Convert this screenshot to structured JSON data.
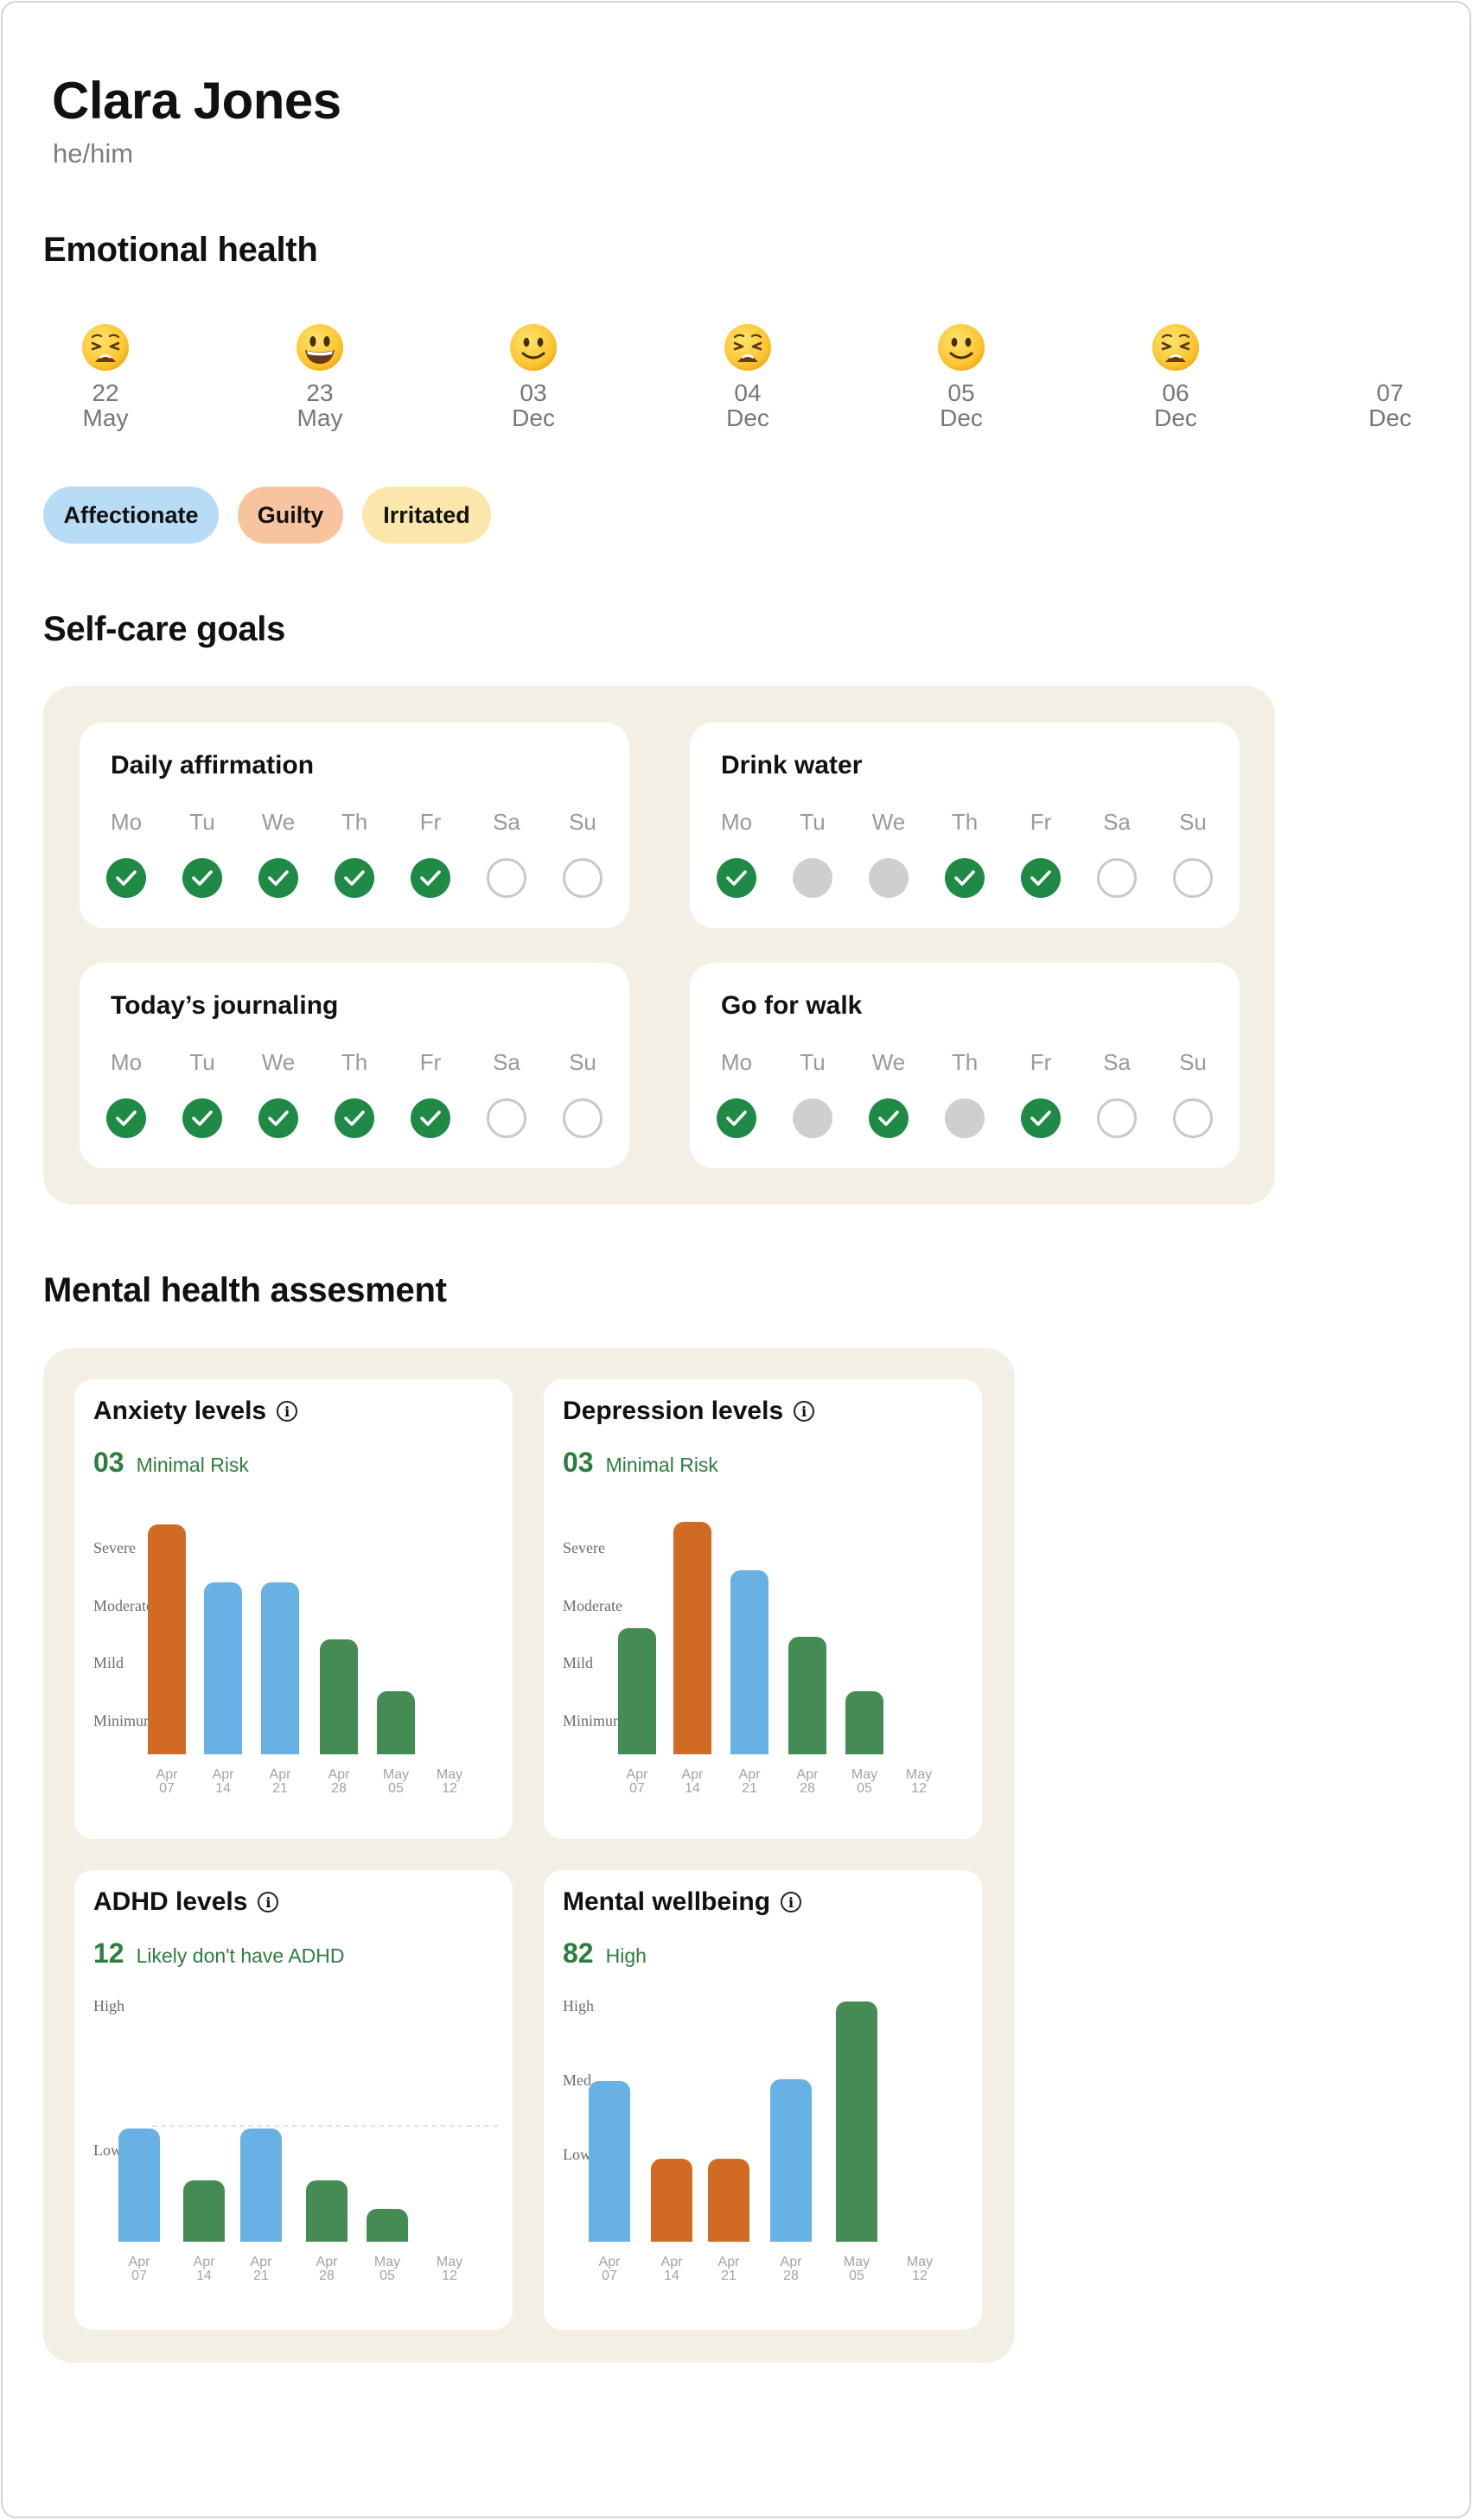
{
  "profile": {
    "name": "Clara Jones",
    "pronouns": "he/him"
  },
  "emotional": {
    "title": "Emotional health",
    "entries": [
      {
        "day": "22",
        "month": "May",
        "mood": "weary-face-icon"
      },
      {
        "day": "23",
        "month": "May",
        "mood": "grinning-face-icon"
      },
      {
        "day": "03",
        "month": "Dec",
        "mood": "slightly-smiling-face-icon"
      },
      {
        "day": "04",
        "month": "Dec",
        "mood": "weary-face-icon"
      },
      {
        "day": "05",
        "month": "Dec",
        "mood": "slightly-smiling-face-icon"
      },
      {
        "day": "06",
        "month": "Dec",
        "mood": "weary-face-icon"
      },
      {
        "day": "07",
        "month": "Dec",
        "mood": ""
      }
    ],
    "tags": [
      {
        "label": "Affectionate",
        "color": "#b9dcf6"
      },
      {
        "label": "Guilty",
        "color": "#f8c4a0"
      },
      {
        "label": "Irritated",
        "color": "#fbe7ab"
      }
    ]
  },
  "selfcare": {
    "title": "Self-care goals",
    "days": [
      "Mo",
      "Tu",
      "We",
      "Th",
      "Fr",
      "Sa",
      "Su"
    ],
    "goals": [
      {
        "title": "Daily affirmation",
        "status": [
          "done",
          "done",
          "done",
          "done",
          "done",
          "empty",
          "empty"
        ]
      },
      {
        "title": "Drink water",
        "status": [
          "done",
          "skip",
          "skip",
          "done",
          "done",
          "empty",
          "empty"
        ]
      },
      {
        "title": "Today’s journaling",
        "status": [
          "done",
          "done",
          "done",
          "done",
          "done",
          "empty",
          "empty"
        ]
      },
      {
        "title": "Go for walk",
        "status": [
          "done",
          "skip",
          "done",
          "skip",
          "done",
          "empty",
          "empty"
        ]
      }
    ]
  },
  "assessment": {
    "title": "Mental health assesment",
    "colors": {
      "green": "#458c54",
      "orange": "#d16b23",
      "blue": "#67b1e4",
      "score": "#2e7d3e"
    }
  },
  "chart_data": [
    {
      "type": "bar",
      "title": "Anxiety levels",
      "score": "03",
      "risk": "Minimal Risk",
      "y_levels": [
        "Severe",
        "Moderate",
        "Mild",
        "Minimum"
      ],
      "ylim": [
        0,
        4.2
      ],
      "categories": [
        [
          "Apr",
          "07"
        ],
        [
          "Apr",
          "14"
        ],
        [
          "Apr",
          "21"
        ],
        [
          "Apr",
          "28"
        ],
        [
          "May",
          "05"
        ],
        [
          "May",
          "12"
        ]
      ],
      "values": [
        4,
        3,
        3,
        2,
        1.1,
        null
      ],
      "colors": [
        "orange",
        "blue",
        "blue",
        "green",
        "green",
        ""
      ]
    },
    {
      "type": "bar",
      "title": "Depression levels",
      "score": "03",
      "risk": "Minimal Risk",
      "y_levels": [
        "Severe",
        "Moderate",
        "Mild",
        "Minimum"
      ],
      "ylim": [
        0,
        4.2
      ],
      "categories": [
        [
          "Apr",
          "07"
        ],
        [
          "Apr",
          "14"
        ],
        [
          "Apr",
          "21"
        ],
        [
          "Apr",
          "28"
        ],
        [
          "May",
          "05"
        ],
        [
          "May",
          "12"
        ]
      ],
      "values": [
        2.2,
        4.05,
        3.2,
        2.05,
        1.1,
        null
      ],
      "colors": [
        "green",
        "orange",
        "blue",
        "green",
        "green",
        ""
      ]
    },
    {
      "type": "bar",
      "title": "ADHD levels",
      "score": "12",
      "risk": "Likely don't have ADHD",
      "y_levels": [
        "High",
        "Low"
      ],
      "ylim": [
        0,
        3
      ],
      "categories": [
        [
          "Apr",
          "07"
        ],
        [
          "Apr",
          "14"
        ],
        [
          "Apr",
          "21"
        ],
        [
          "Apr",
          "28"
        ],
        [
          "May",
          "05"
        ],
        [
          "May",
          "12"
        ]
      ],
      "values": [
        2.0,
        1.08,
        2.0,
        1.08,
        0.58,
        null
      ],
      "colors": [
        "blue",
        "green",
        "blue",
        "green",
        "green",
        ""
      ]
    },
    {
      "type": "bar",
      "title": "Mental wellbeing",
      "score": "82",
      "risk": "High",
      "y_levels": [
        "High",
        "Med",
        "Low"
      ],
      "ylim": [
        0,
        3.25
      ],
      "categories": [
        [
          "Apr",
          "07"
        ],
        [
          "Apr",
          "14"
        ],
        [
          "Apr",
          "21"
        ],
        [
          "Apr",
          "28"
        ],
        [
          "May",
          "05"
        ],
        [
          "May",
          "12"
        ]
      ],
      "values": [
        2.18,
        1.12,
        1.12,
        2.2,
        3.25,
        null
      ],
      "colors": [
        "blue",
        "orange",
        "orange",
        "blue",
        "green",
        ""
      ]
    }
  ]
}
